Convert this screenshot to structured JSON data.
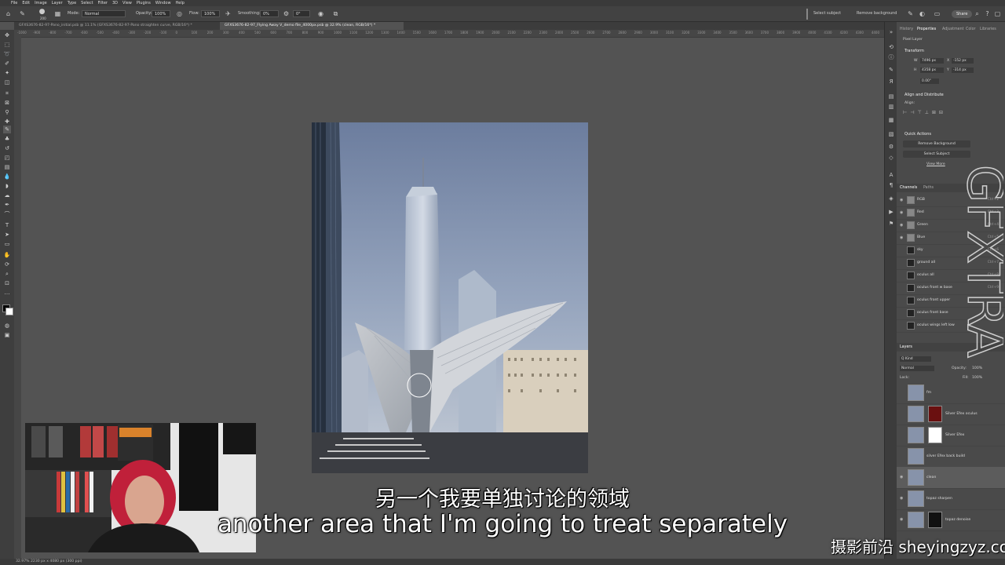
{
  "menu": [
    "File",
    "Edit",
    "Image",
    "Layer",
    "Type",
    "Select",
    "Filter",
    "3D",
    "View",
    "Plugins",
    "Window",
    "Help"
  ],
  "options": {
    "mode_label": "Mode:",
    "mode_value": "Normal",
    "opacity_label": "Opacity:",
    "opacity_value": "100%",
    "flow_label": "Flow:",
    "flow_value": "100%",
    "smoothing_label": "Smoothing:",
    "smoothing_value": "0%",
    "angle_value": "0°",
    "brush_size": "200",
    "select_subject": "Select subject",
    "remove_background": "Remove background",
    "share": "Share"
  },
  "tabs": [
    {
      "label": "GFXS3676-82-97-Pano_initial.psb @ 11.1% (GFXS3676-82-97-Pano straighten curve, RGB/16*) *"
    },
    {
      "label": "GFXS3676-82-97_Flying Away V_demo file_4000px.psb @ 32.9% (clean, RGB/16*) *"
    }
  ],
  "ruler_ticks": [
    "-1000",
    "-900",
    "-800",
    "-700",
    "-600",
    "-500",
    "-400",
    "-300",
    "-200",
    "-100",
    "0",
    "100",
    "200",
    "300",
    "400",
    "500",
    "600",
    "700",
    "800",
    "900",
    "1000",
    "1100",
    "1200",
    "1300",
    "1400",
    "1500",
    "1600",
    "1700",
    "1800",
    "1900",
    "2000",
    "2100",
    "2200",
    "2300",
    "2400",
    "2500",
    "2600",
    "2700",
    "2800",
    "2900",
    "3000",
    "3100",
    "3200",
    "3300",
    "3400",
    "3500",
    "3600",
    "3700",
    "3800",
    "3900",
    "4000",
    "4100",
    "4200",
    "4300",
    "4400"
  ],
  "panel": {
    "tabs": [
      "History",
      "Properties",
      "Adjustment",
      "Color",
      "Libraries"
    ],
    "pixel_layer": "Pixel Layer",
    "transform": "Transform",
    "w_label": "W",
    "w_value": "7496 px",
    "h_label": "H",
    "h_value": "4358 px",
    "x_label": "X",
    "x_value": "-152 px",
    "y_label": "Y",
    "y_value": "-314 px",
    "angle_value": "0.00°",
    "align_title": "Align and Distribute",
    "align_label": "Align:",
    "quick_actions": "Quick Actions",
    "remove_bg_btn": "Remove Background",
    "select_subject_btn": "Select Subject",
    "view_more": "View More"
  },
  "channels": {
    "tabs": [
      "Channels",
      "Paths"
    ],
    "rows": [
      {
        "name": "RGB",
        "shortcut": "Ctrl+2"
      },
      {
        "name": "Red",
        "shortcut": "Ctrl+3"
      },
      {
        "name": "Green",
        "shortcut": "Ctrl+4"
      },
      {
        "name": "Blue",
        "shortcut": "Ctrl+5"
      },
      {
        "name": "sky",
        "shortcut": "Ctrl+6"
      },
      {
        "name": "ground all",
        "shortcut": "Ctrl+7"
      },
      {
        "name": "oculus all",
        "shortcut": "Ctrl+8"
      },
      {
        "name": "oculus front w base",
        "shortcut": "Ctrl+9"
      },
      {
        "name": "oculus front upper",
        "shortcut": ""
      },
      {
        "name": "oculus front base",
        "shortcut": ""
      },
      {
        "name": "oculus wings left low",
        "shortcut": ""
      }
    ]
  },
  "layers": {
    "title": "Layers",
    "kind_label": "Q Kind",
    "blend_mode": "Normal",
    "opacity_label": "Opacity:",
    "opacity_value": "100%",
    "lock_label": "Lock:",
    "fill_label": "Fill:",
    "fill_value": "100%",
    "rows": [
      {
        "name": "fm"
      },
      {
        "name": "Silver Efex oculus"
      },
      {
        "name": "Silver Efex"
      },
      {
        "name": "silver Efex back build"
      },
      {
        "name": "clean"
      },
      {
        "name": "topaz sharpen"
      },
      {
        "name": "topaz denoise"
      }
    ]
  },
  "status": "32.97%   2230 px x 4080 px (300 ppi)",
  "subtitle_cn": "另一个我要单独讨论的领域",
  "subtitle_en": "another area that I'm going to treat separately",
  "watermark": "摄影前沿 sheyingzyz.com",
  "watermark_side": "GFXTRA"
}
